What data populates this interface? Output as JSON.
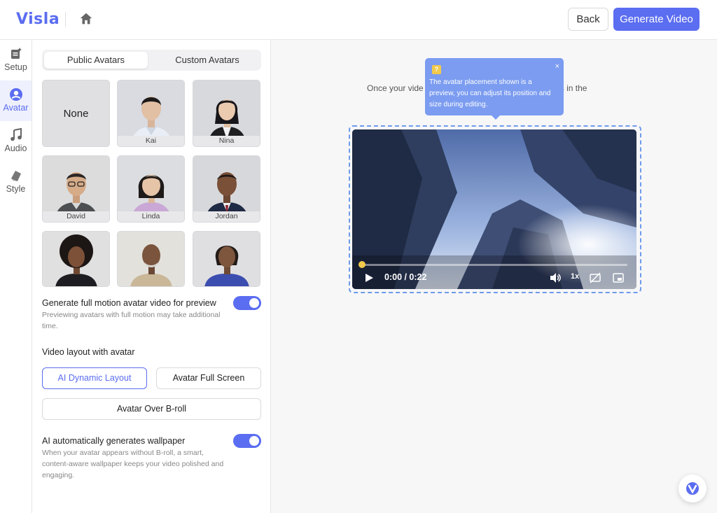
{
  "header": {
    "logo": "Visla",
    "home_icon": "home-icon",
    "back_label": "Back",
    "generate_label": "Generate Video",
    "accent_color": "#5b6df0"
  },
  "rail": {
    "items": [
      {
        "label": "Setup",
        "icon": "setup-icon",
        "active": false
      },
      {
        "label": "Avatar",
        "icon": "avatar-icon",
        "active": true
      },
      {
        "label": "Audio",
        "icon": "music-note-icon",
        "active": false
      },
      {
        "label": "Style",
        "icon": "style-icon",
        "active": false
      }
    ]
  },
  "panel": {
    "tabs": [
      {
        "label": "Public Avatars",
        "active": true
      },
      {
        "label": "Custom Avatars",
        "active": false
      }
    ],
    "avatars": [
      {
        "name": "None"
      },
      {
        "name": "Kai"
      },
      {
        "name": "Nina"
      },
      {
        "name": "David"
      },
      {
        "name": "Linda"
      },
      {
        "name": "Jordan"
      },
      {
        "name": ""
      },
      {
        "name": ""
      },
      {
        "name": ""
      }
    ],
    "full_motion": {
      "title": "Generate full motion avatar video for preview",
      "desc": "Previewing avatars with full motion may take additional time.",
      "enabled": true
    },
    "layout": {
      "title": "Video layout with avatar",
      "options": [
        "AI Dynamic Layout",
        "Avatar Full Screen",
        "Avatar Over B-roll"
      ],
      "selected": "AI Dynamic Layout"
    },
    "wallpaper": {
      "title": "AI automatically generates wallpaper",
      "desc": "When your avatar appears without B-roll, a smart, content-aware wallpaper keeps your video polished and engaging.",
      "enabled": true
    }
  },
  "main": {
    "info_left": "Once your vide",
    "info_right": "onal edits in the",
    "tooltip": {
      "text": "The avatar placement shown is a preview, you can adjust its position and size during editing.",
      "close": "×",
      "help": "?"
    },
    "video": {
      "time": "0:00 / 0:22",
      "speed": "1x",
      "progress": 0.01
    }
  }
}
